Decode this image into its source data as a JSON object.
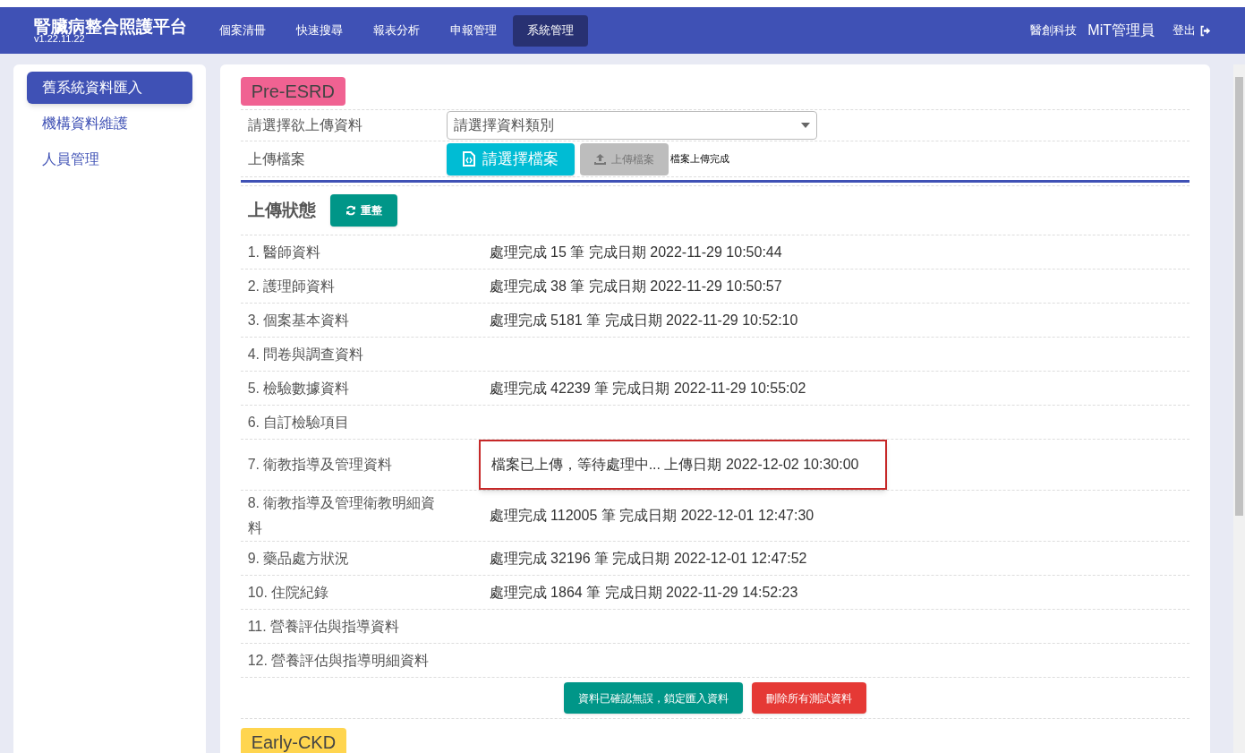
{
  "header": {
    "title": "腎臟病整合照護平台",
    "version": "v1.22.11.22",
    "nav": [
      {
        "label": "個案清冊",
        "selected": false
      },
      {
        "label": "快速搜尋",
        "selected": false
      },
      {
        "label": "報表分析",
        "selected": false
      },
      {
        "label": "申報管理",
        "selected": false
      },
      {
        "label": "系統管理",
        "selected": true
      }
    ],
    "company": "醫創科技",
    "user": "MiT管理員",
    "logout": "登出"
  },
  "sidebar": {
    "items": [
      {
        "label": "舊系統資料匯入",
        "selected": true
      },
      {
        "label": "機構資料維護",
        "selected": false
      },
      {
        "label": "人員管理",
        "selected": false
      }
    ]
  },
  "sections": [
    {
      "tag": "Pre-ESRD",
      "color": "#f06292",
      "select_label": "請選擇欲上傳資料",
      "select_value": "請選擇資料類別",
      "file_label": "上傳檔案",
      "choose_button": "請選擇檔案",
      "upload_button": "上傳檔案",
      "upload_disabled": true,
      "upload_message": "檔案上傳完成",
      "status_title": "上傳狀態",
      "refresh_button": "重整",
      "rows": [
        {
          "name": "1. 醫師資料",
          "status": "處理完成 15 筆 完成日期 2022-11-29 10:50:44",
          "highlighted": false
        },
        {
          "name": "2. 護理師資料",
          "status": "處理完成 38 筆 完成日期 2022-11-29 10:50:57",
          "highlighted": false
        },
        {
          "name": "3. 個案基本資料",
          "status": "處理完成 5181 筆 完成日期 2022-11-29 10:52:10",
          "highlighted": false
        },
        {
          "name": "4. 問卷與調查資料",
          "highlighted": false
        },
        {
          "name": "5. 檢驗數據資料",
          "status": "處理完成 42239 筆 完成日期 2022-11-29 10:55:02",
          "highlighted": false
        },
        {
          "name": "6. 自訂檢驗項目",
          "highlighted": false
        },
        {
          "name": "7. 衛教指導及管理資料",
          "status": "檔案已上傳，等待處理中... 上傳日期 2022-12-02 10:30:00",
          "highlighted": true
        },
        {
          "name": "8. 衛教指導及管理衛教明細資料",
          "status": "處理完成 112005 筆 完成日期 2022-12-01 12:47:30",
          "highlighted": false
        },
        {
          "name": "9. 藥品處方狀況",
          "status": "處理完成 32196 筆 完成日期 2022-12-01 12:47:52",
          "highlighted": false
        },
        {
          "name": "10. 住院紀錄",
          "status": "處理完成 1864 筆 完成日期 2022-11-29 14:52:23",
          "highlighted": false
        },
        {
          "name": "11. 營養評估與指導資料",
          "highlighted": false
        },
        {
          "name": "12. 營養評估與指導明細資料",
          "highlighted": false
        }
      ],
      "confirm_button": "資料已確認無誤，鎖定匯入資料",
      "delete_button": "刪除所有測試資料"
    },
    {
      "tag": "Early-CKD",
      "color": "#ffd54f"
    }
  ]
}
